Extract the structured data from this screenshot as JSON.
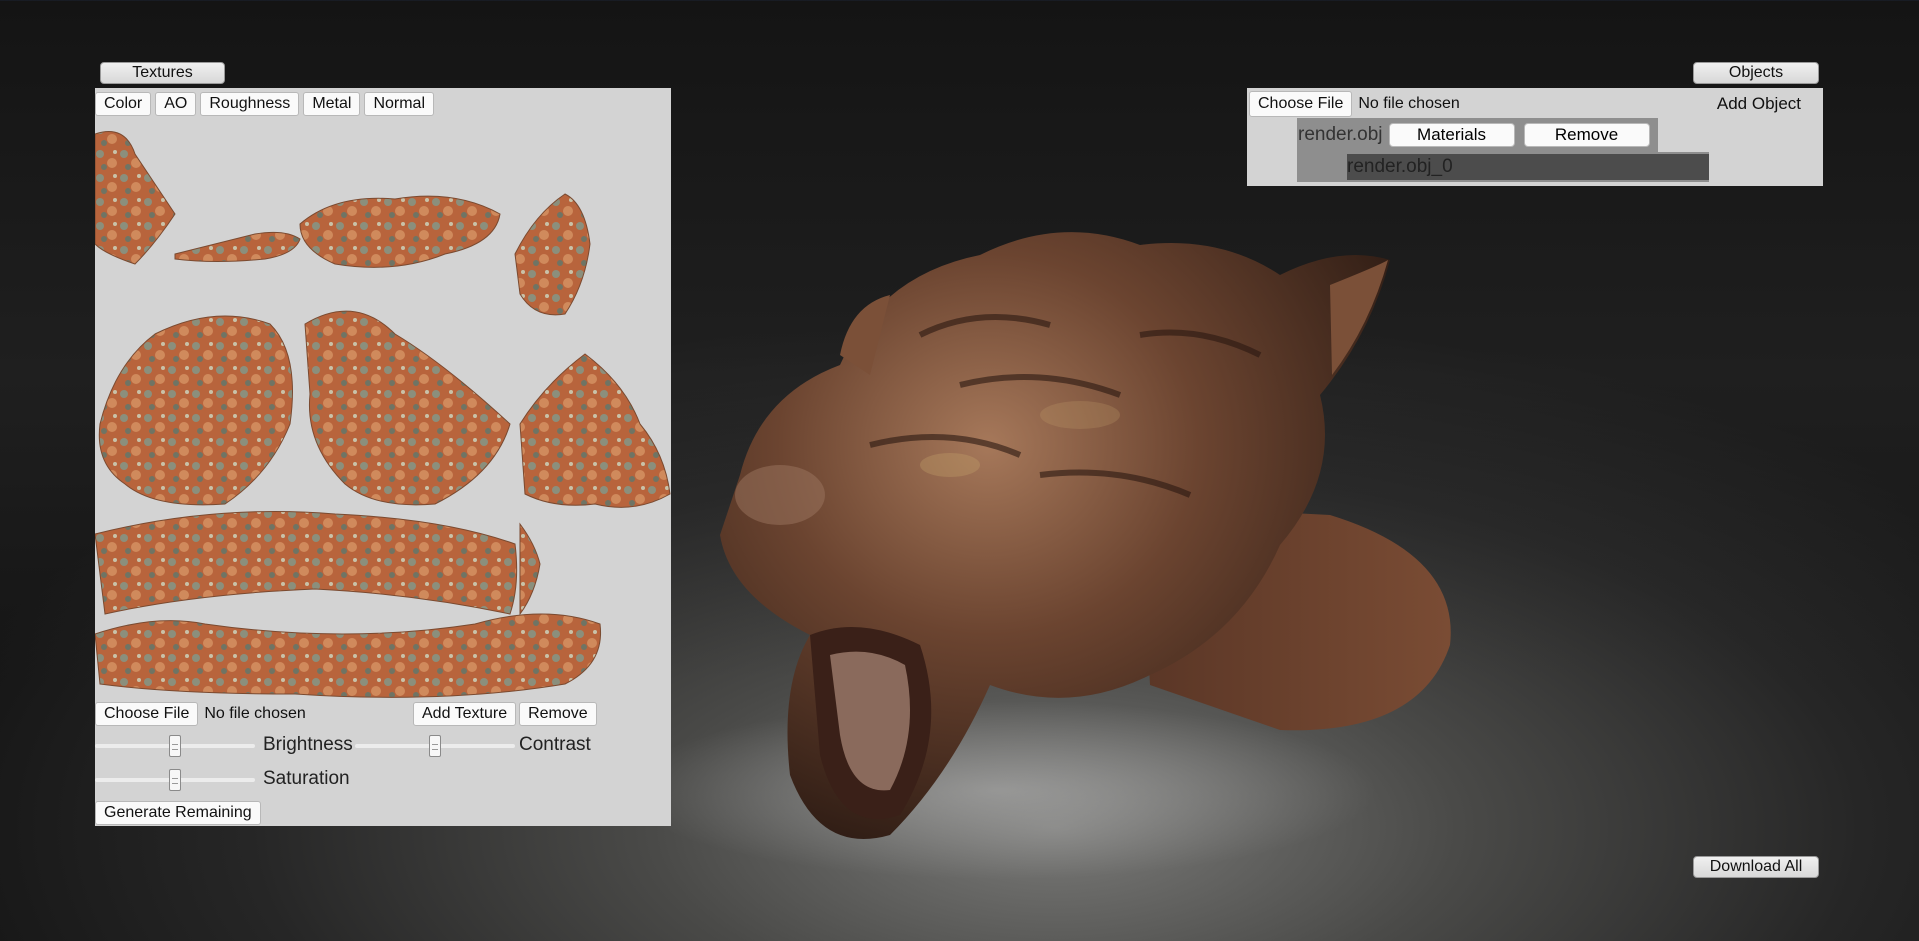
{
  "textures": {
    "header_label": "Textures",
    "tabs": [
      "Color",
      "AO",
      "Roughness",
      "Metal",
      "Normal"
    ],
    "file_button": "Choose File",
    "file_status": "No file chosen",
    "add_texture": "Add Texture",
    "remove": "Remove",
    "sliders": {
      "brightness": {
        "label": "Brightness",
        "value": 0.5
      },
      "contrast": {
        "label": "Contrast",
        "value": 0.5
      },
      "saturation": {
        "label": "Saturation",
        "value": 0.5
      }
    },
    "generate_remaining": "Generate Remaining"
  },
  "objects": {
    "header_label": "Objects",
    "file_button": "Choose File",
    "file_status": "No file chosen",
    "add_object": "Add Object",
    "items": [
      {
        "name": "render.obj",
        "materials_label": "Materials",
        "remove_label": "Remove",
        "materials": [
          "render.obj_0"
        ]
      }
    ]
  },
  "download_all": "Download All",
  "colors": {
    "panel_bg": "#d3d3d3",
    "object_row_bg": "#8e8e8e",
    "material_row_bg": "#4c4c4c",
    "rust": "#b8643c",
    "bronze": "#6b4430"
  }
}
